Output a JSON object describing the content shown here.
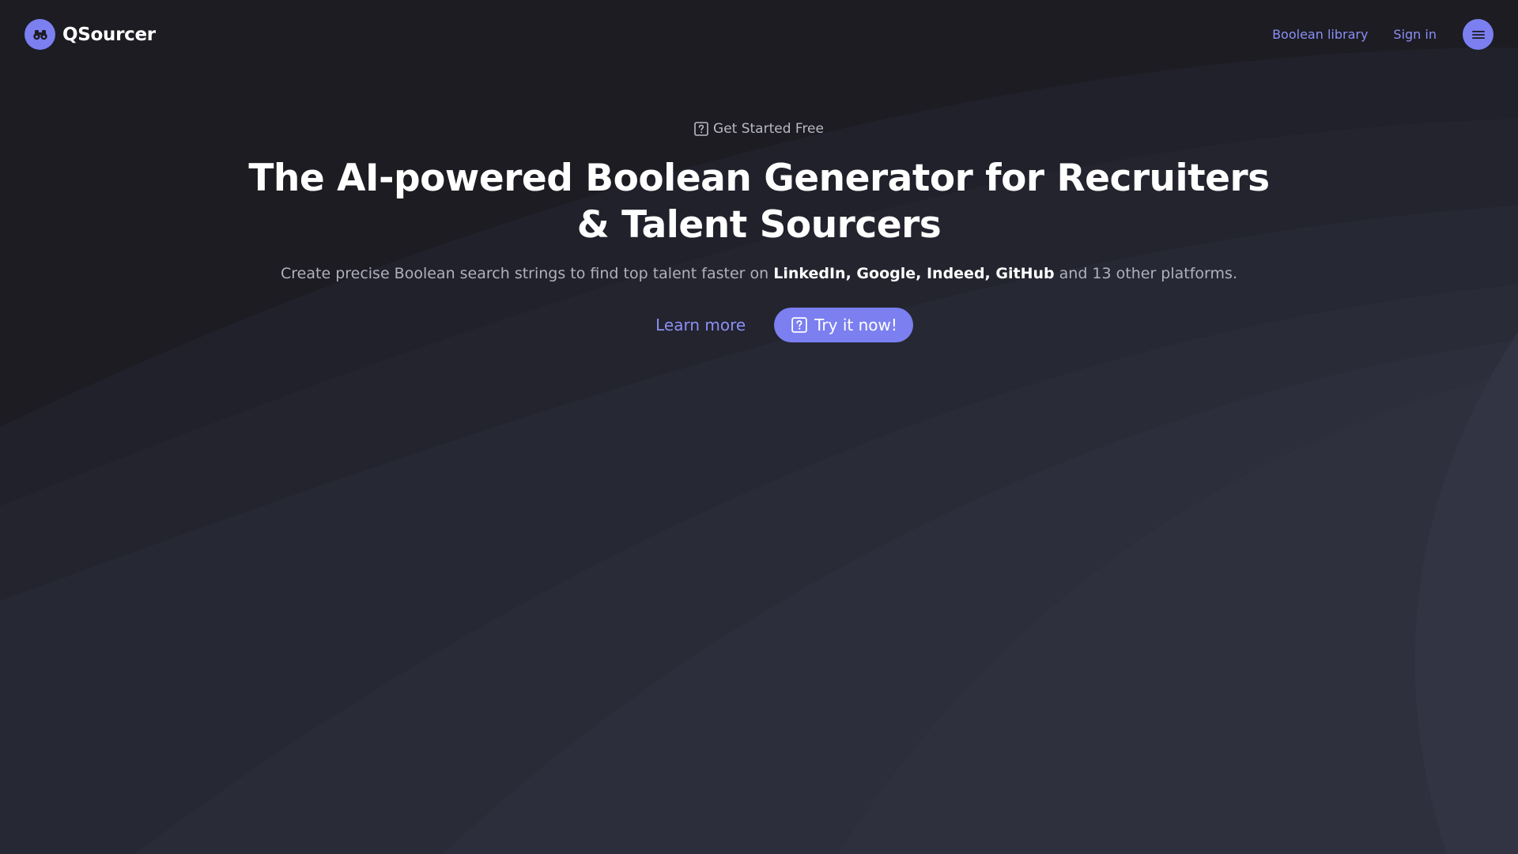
{
  "brand": {
    "name": "QSourcer",
    "logo_icon": "binoculars-icon",
    "color": "#7b7ff0"
  },
  "nav": {
    "links": [
      {
        "label": "Boolean library"
      },
      {
        "label": "Sign in"
      }
    ],
    "menu_icon": "hamburger-menu-icon"
  },
  "hero": {
    "eyebrow": {
      "icon": "question-square-icon",
      "label": "Get Started Free"
    },
    "title": "The AI-powered Boolean Generator for Recruiters & Talent Sourcers",
    "subtitle": {
      "prefix": "Create precise Boolean search strings to find top talent faster on ",
      "platforms": [
        "LinkedIn",
        "Google",
        "Indeed",
        "GitHub"
      ],
      "suffix": " and 13 other platforms."
    },
    "learn_more_label": "Learn more",
    "try_button": {
      "icon": "question-square-icon",
      "label": "Try it now!"
    }
  },
  "colors": {
    "background": "#1c1c22",
    "accent": "#7b7ff0",
    "link": "#8b8ff5",
    "muted_text": "#b0b1bd"
  }
}
